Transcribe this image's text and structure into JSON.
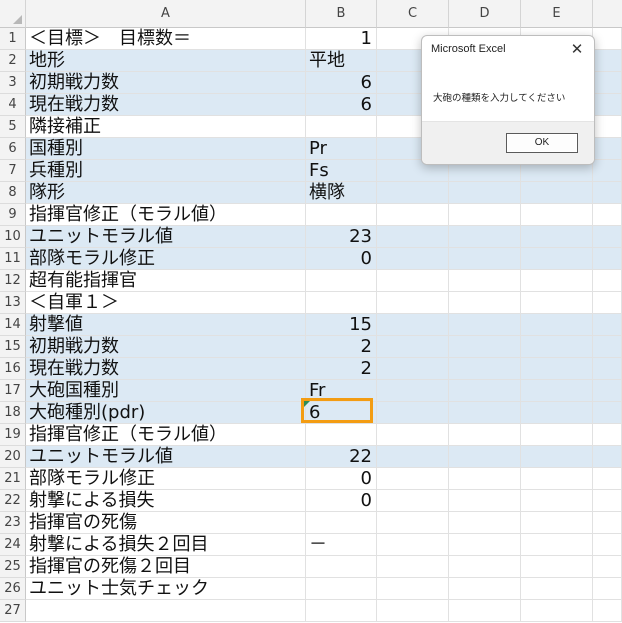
{
  "colors": {
    "band": "#dce9f4",
    "selection": "#f39c12",
    "header_bg": "#f3f3f3"
  },
  "columns": [
    "A",
    "B",
    "C",
    "D",
    "E"
  ],
  "rows": [
    {
      "n": "1",
      "a": "＜目標＞　目標数＝",
      "b": "1",
      "num": true,
      "band": false
    },
    {
      "n": "2",
      "a": "地形",
      "b": "平地",
      "num": false,
      "band": true
    },
    {
      "n": "3",
      "a": "初期戦力数",
      "b": "6",
      "num": true,
      "band": true
    },
    {
      "n": "4",
      "a": "現在戦力数",
      "b": "6",
      "num": true,
      "band": true
    },
    {
      "n": "5",
      "a": "隣接補正",
      "b": "",
      "num": false,
      "band": false
    },
    {
      "n": "6",
      "a": "国種別",
      "b": "Pr",
      "num": false,
      "band": true
    },
    {
      "n": "7",
      "a": "兵種別",
      "b": "Fs",
      "num": false,
      "band": true
    },
    {
      "n": "8",
      "a": "隊形",
      "b": "横隊",
      "num": false,
      "band": true
    },
    {
      "n": "9",
      "a": "指揮官修正（モラル値）",
      "b": "",
      "num": false,
      "band": false
    },
    {
      "n": "10",
      "a": "ユニットモラル値",
      "b": "23",
      "num": true,
      "band": true
    },
    {
      "n": "11",
      "a": "部隊モラル修正",
      "b": "0",
      "num": true,
      "band": true
    },
    {
      "n": "12",
      "a": "超有能指揮官",
      "b": "",
      "num": false,
      "band": false
    },
    {
      "n": "13",
      "a": "＜自軍１＞",
      "b": "",
      "num": false,
      "band": false
    },
    {
      "n": "14",
      "a": "射撃値",
      "b": "15",
      "num": true,
      "band": true
    },
    {
      "n": "15",
      "a": "初期戦力数",
      "b": "2",
      "num": true,
      "band": true
    },
    {
      "n": "16",
      "a": "現在戦力数",
      "b": "2",
      "num": true,
      "band": true
    },
    {
      "n": "17",
      "a": "大砲国種別",
      "b": "Fr",
      "num": false,
      "band": true
    },
    {
      "n": "18",
      "a": "大砲種別(pdr)",
      "b": "6",
      "num": false,
      "band": true
    },
    {
      "n": "19",
      "a": "指揮官修正（モラル値）",
      "b": "",
      "num": false,
      "band": false
    },
    {
      "n": "20",
      "a": "ユニットモラル値",
      "b": "22",
      "num": true,
      "band": true
    },
    {
      "n": "21",
      "a": "部隊モラル修正",
      "b": "0",
      "num": true,
      "band": false
    },
    {
      "n": "22",
      "a": "射撃による損失",
      "b": "0",
      "num": true,
      "band": false
    },
    {
      "n": "23",
      "a": "指揮官の死傷",
      "b": "",
      "num": false,
      "band": false
    },
    {
      "n": "24",
      "a": "射撃による損失２回目",
      "b": "－",
      "num": false,
      "band": false
    },
    {
      "n": "25",
      "a": "指揮官の死傷２回目",
      "b": "",
      "num": false,
      "band": false
    },
    {
      "n": "26",
      "a": "ユニット士気チェック",
      "b": "",
      "num": false,
      "band": false
    },
    {
      "n": "27",
      "a": "",
      "b": "",
      "num": false,
      "band": false
    }
  ],
  "selected_cell": "B18",
  "dialog": {
    "title": "Microsoft Excel",
    "close_icon": "close-icon",
    "message": "大砲の種類を入力してください",
    "ok_label": "OK"
  }
}
